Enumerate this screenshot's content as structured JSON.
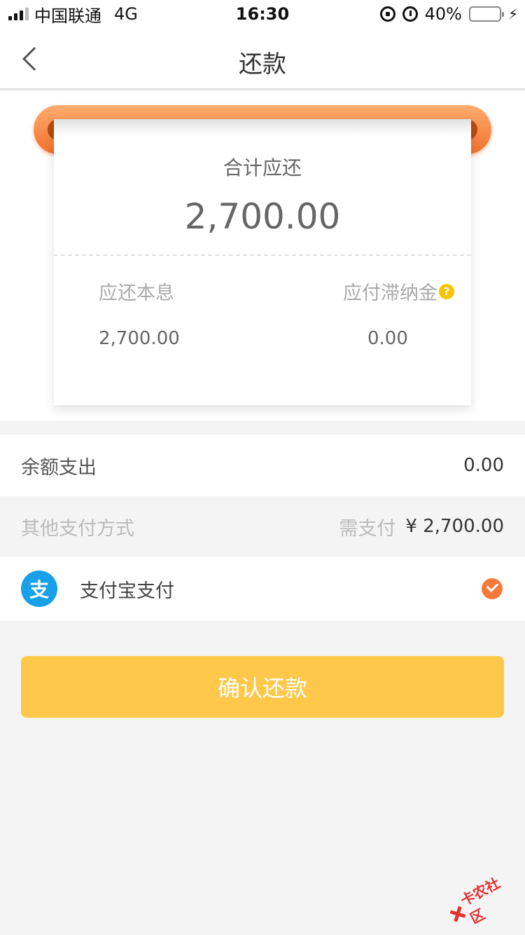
{
  "status_bar": {
    "carrier": "中国联通",
    "network": "4G",
    "time": "16:30",
    "battery": "40%",
    "battery_level": 0.4
  },
  "nav": {
    "title": "还款"
  },
  "summary": {
    "total_label": "合计应还",
    "total_value": "2,700.00",
    "principal_label": "应还本息",
    "principal_value": "2,700.00",
    "late_fee_label": "应付滞纳金",
    "late_fee_value": "0.00",
    "help_glyph": "?"
  },
  "balance": {
    "label": "余额支出",
    "value": "0.00"
  },
  "other_payment": {
    "label": "其他支付方式",
    "need_label": "需支付",
    "need_value": "¥ 2,700.00"
  },
  "alipay": {
    "logo_glyph": "支",
    "label": "支付宝支付",
    "selected": true
  },
  "confirm": {
    "label": "确认还款"
  },
  "watermark": {
    "text": "卡农社区"
  },
  "colors": {
    "accent_orange": "#f47a3c",
    "button_yellow": "#ffc84b",
    "alipay_blue": "#18a0e8",
    "help_yellow": "#f8c400"
  }
}
